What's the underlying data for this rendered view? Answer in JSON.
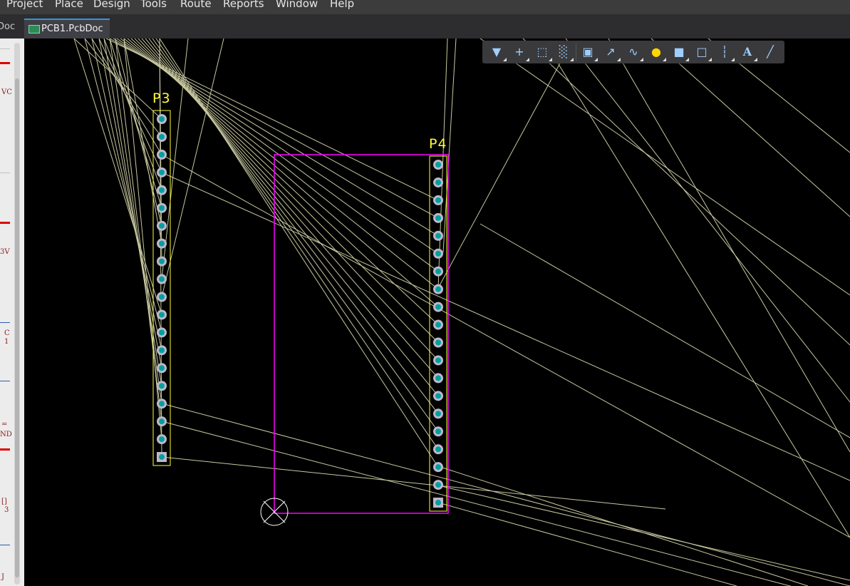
{
  "menu": {
    "items": [
      "Project",
      "Place",
      "Design",
      "Tools",
      "Route",
      "Reports",
      "Window",
      "Help"
    ]
  },
  "tabs": {
    "left_fragment": "Doc",
    "active_label": "PCB1.PcbDoc *"
  },
  "left_panel": {
    "fragments": [
      "VC",
      "3V",
      "C",
      "1",
      "=",
      "ND",
      "[]",
      "3",
      "J"
    ]
  },
  "toolbar": {
    "buttons": [
      {
        "icon": "filter-icon",
        "glyph": "▼"
      },
      {
        "icon": "crosshair-icon",
        "glyph": "+"
      },
      {
        "icon": "select-rectangle-icon",
        "glyph": "⬚"
      },
      {
        "icon": "align-icon",
        "glyph": "░"
      },
      {
        "icon": "component-icon",
        "glyph": "▣"
      },
      {
        "icon": "route-icon",
        "glyph": "↗"
      },
      {
        "icon": "interactive-tune-icon",
        "glyph": "∿"
      },
      {
        "icon": "via-icon",
        "glyph": "●"
      },
      {
        "icon": "fill-icon",
        "glyph": "■"
      },
      {
        "icon": "region-icon",
        "glyph": "□"
      },
      {
        "icon": "dimension-icon",
        "glyph": "┆"
      },
      {
        "icon": "text-icon",
        "glyph": "A"
      },
      {
        "icon": "line-icon",
        "glyph": "╱"
      }
    ]
  },
  "board": {
    "designators": {
      "p3": "P3",
      "p4": "P4"
    },
    "pin_count": 20,
    "colors": {
      "background": "#000000",
      "ratsnest": "#c8c8a0",
      "silkscreen": "#ffff33",
      "outline": "#ff00ff",
      "pad": "#c0b8c8",
      "pad_hole": "#00a0a0",
      "origin": "#ffffff"
    }
  }
}
